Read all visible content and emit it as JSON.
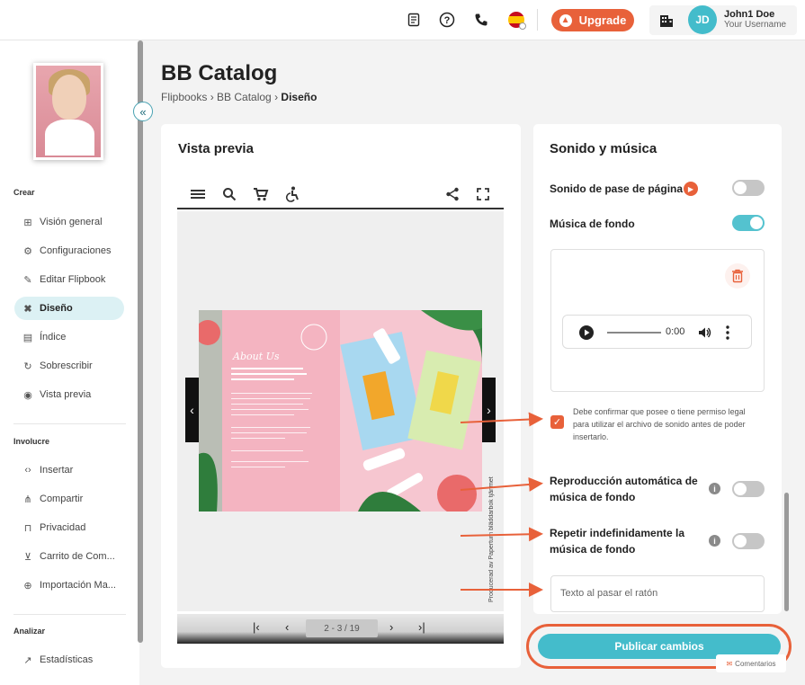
{
  "topbar": {
    "icons": [
      "document-icon",
      "help-icon",
      "phone-icon",
      "spain-flag-icon"
    ],
    "upgrade_label": "Upgrade",
    "user": {
      "initials": "JD",
      "name": "John1 Doe",
      "subtitle": "Your Username"
    }
  },
  "sidebar": {
    "sections": [
      {
        "title": "Crear",
        "items": [
          {
            "label": "Visión general",
            "icon": "grid-icon"
          },
          {
            "label": "Configuraciones",
            "icon": "gear-icon"
          },
          {
            "label": "Editar Flipbook",
            "icon": "pencil-icon"
          },
          {
            "label": "Diseño",
            "icon": "design-icon",
            "active": true
          },
          {
            "label": "Índice",
            "icon": "index-icon"
          },
          {
            "label": "Sobrescribir",
            "icon": "refresh-icon"
          },
          {
            "label": "Vista previa",
            "icon": "eye-icon"
          }
        ]
      },
      {
        "title": "Involucre",
        "items": [
          {
            "label": "Insertar",
            "icon": "code-icon"
          },
          {
            "label": "Compartir",
            "icon": "share-icon"
          },
          {
            "label": "Privacidad",
            "icon": "lock-icon"
          },
          {
            "label": "Carrito de Com...",
            "icon": "cart-icon"
          },
          {
            "label": "Importación Ma...",
            "icon": "import-icon"
          }
        ]
      },
      {
        "title": "Analizar",
        "items": [
          {
            "label": "Estadísticas",
            "icon": "stats-icon"
          }
        ]
      }
    ]
  },
  "page": {
    "title": "BB Catalog",
    "breadcrumb": [
      "Flipbooks",
      "BB Catalog",
      "Diseño"
    ]
  },
  "preview": {
    "title": "Vista previa",
    "page_indicator": "2 - 3 / 19",
    "credit": "Producerad av Paperturn bläddarbok tjänmet"
  },
  "sound": {
    "title": "Sonido y música",
    "page_turn_label": "Sonido de pase de página",
    "page_turn_on": false,
    "bg_music_label": "Música de fondo",
    "bg_music_on": true,
    "audio_time": "0:00",
    "legal_text": "Debe confirmar que posee o tiene permiso legal para utilizar el archivo de sonido antes de poder insertarlo.",
    "legal_checked": true,
    "autoplay_label": "Reproducción automática de música de fondo",
    "autoplay_on": false,
    "loop_label": "Repetir indefinidamente la música de fondo",
    "loop_on": false,
    "hover_placeholder": "Texto al pasar el ratón"
  },
  "publish_label": "Publicar cambios",
  "comment_label": "Comentarios",
  "colors": {
    "accent": "#e8613a",
    "teal": "#44bccb",
    "active_bg": "#dcf1f4"
  }
}
